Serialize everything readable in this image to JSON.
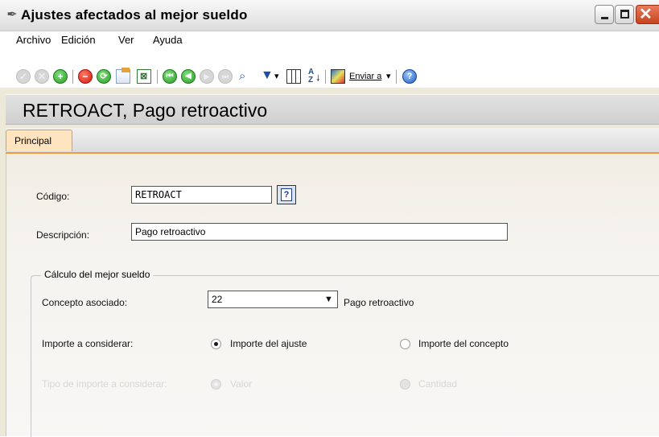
{
  "window": {
    "title": "Ajustes afectados al mejor sueldo",
    "title_icon": "quill-pen-icon"
  },
  "menu": {
    "archivo": "Archivo",
    "edicion": "Edición",
    "ver": "Ver",
    "ayuda": "Ayuda"
  },
  "toolbar": {
    "enviar_label": "Enviar a",
    "enviar_arrow": "▾",
    "filter_arrow": "▾"
  },
  "header": {
    "title": "RETROACT, Pago retroactivo"
  },
  "tabs": {
    "principal": "Principal"
  },
  "form": {
    "codigo_label": "Código:",
    "codigo_value": "RETROACT",
    "help_button": "?",
    "descripcion_label": "Descripción:",
    "descripcion_value": "Pago retroactivo"
  },
  "group": {
    "legend": "Cálculo del mejor sueldo",
    "concepto_label": "Concepto asociado:",
    "concepto_value": "22",
    "concepto_desc": "Pago retroactivo",
    "importe_label": "Importe a considerar:",
    "importe_ajuste": "Importe del ajuste",
    "importe_concepto": "Importe del concepto",
    "importe_selected": "Importe del ajuste",
    "tipo_label": "Tipo de importe a considerar:",
    "tipo_valor": "Valor",
    "tipo_cantidad": "Cantidad",
    "tipo_selected": "Valor",
    "tipo_enabled": false
  },
  "colors": {
    "tab_accent": "#f29a3c",
    "close_button": "#c6441e",
    "confirm_green": "#2d9a2a",
    "delete_red": "#d2190b"
  }
}
